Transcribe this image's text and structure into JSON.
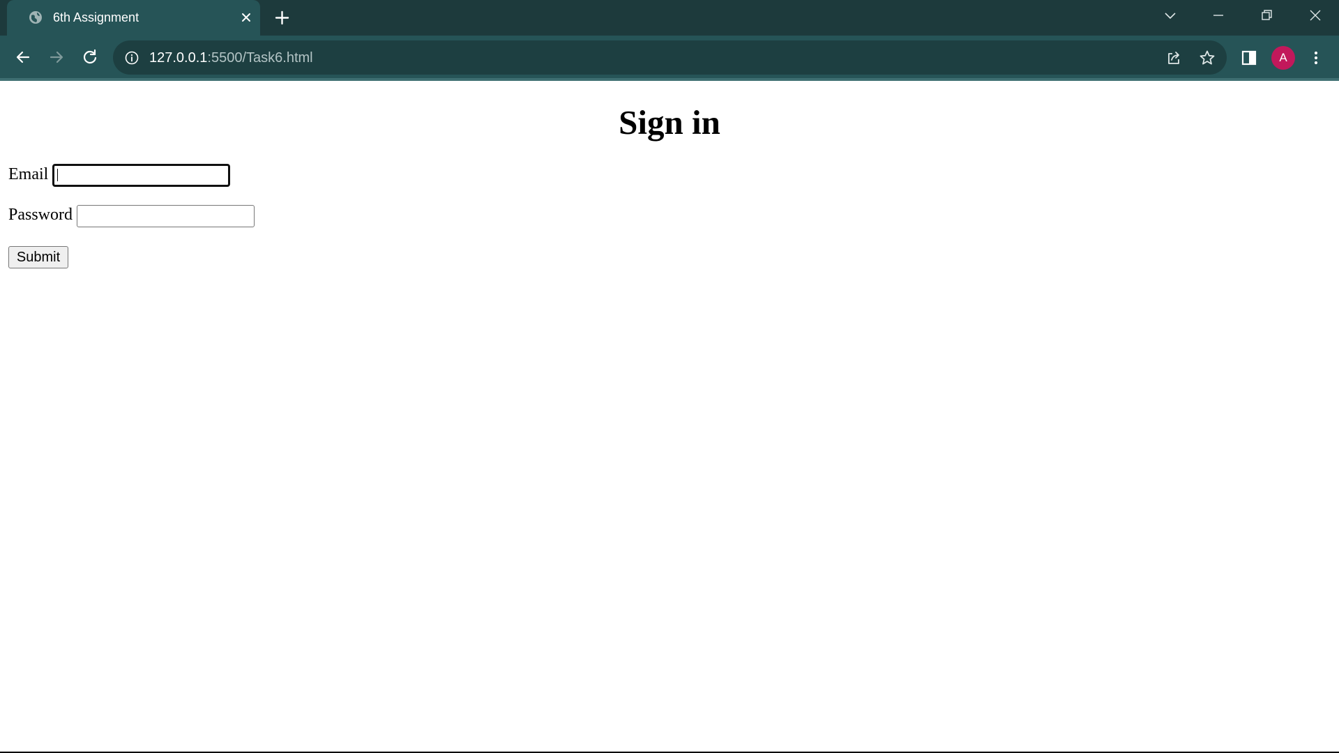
{
  "browser": {
    "tab": {
      "title": "6th Assignment"
    },
    "address": {
      "host": "127.0.0.1",
      "rest": ":5500/Task6.html"
    },
    "profile_initial": "A",
    "icons": {
      "favicon": "globe-icon",
      "tab_close": "close-icon",
      "new_tab": "plus-icon",
      "tab_search": "chevron-down-icon",
      "minimize": "minimize-icon",
      "restore": "restore-icon",
      "window_close": "close-icon",
      "back": "arrow-left-icon",
      "forward": "arrow-right-icon",
      "reload": "reload-icon",
      "site_info": "info-icon",
      "share": "share-icon",
      "bookmark": "star-icon",
      "side_panel": "side-panel-icon",
      "menu": "kebab-menu-icon"
    },
    "colors": {
      "tabbar": "#1d3a3c",
      "toolbar": "#265457",
      "omnibox": "#1d3f41",
      "avatar": "#c2185b"
    }
  },
  "page": {
    "title": "Sign in",
    "email_label": "Email",
    "email_value": "",
    "password_label": "Password",
    "password_value": "",
    "submit_label": "Submit"
  }
}
